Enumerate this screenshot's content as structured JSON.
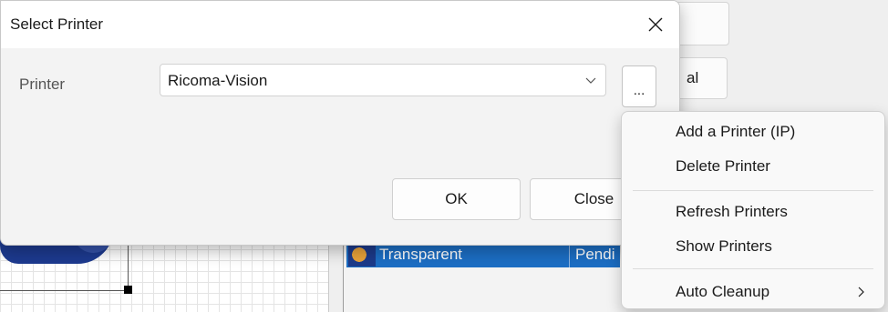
{
  "background": {
    "partial_button_text": "al",
    "list_row": {
      "name": "Transparent",
      "status": "Pendi"
    }
  },
  "dialog": {
    "title": "Select Printer",
    "close_icon": "close-icon",
    "printer_label": "Printer",
    "printer_value": "Ricoma-Vision",
    "dropdown_icon": "chevron-down-icon",
    "more_button_label": "...",
    "ok_label": "OK",
    "close_label": "Close"
  },
  "context_menu": {
    "items": [
      {
        "label": "Add a Printer (IP)"
      },
      {
        "label": "Delete Printer"
      },
      {
        "label": "Refresh Printers"
      },
      {
        "label": "Show Printers"
      },
      {
        "label": "Auto Cleanup",
        "submenu_icon": "chevron-right-icon"
      }
    ]
  },
  "colors": {
    "selection": "#1c6ec4",
    "dialog_bg": "#f3f3f3",
    "menu_bg": "#f9f9f9"
  }
}
